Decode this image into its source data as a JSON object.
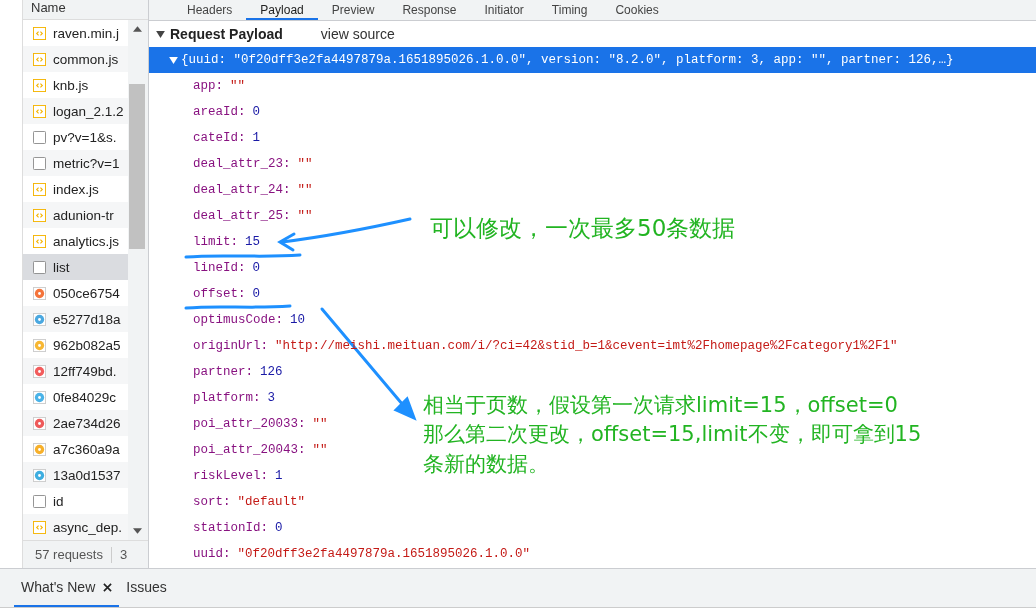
{
  "network_list": {
    "header": "Name",
    "items": [
      {
        "name": "raven.min.j",
        "kind": "script",
        "selected": false
      },
      {
        "name": "common.js",
        "kind": "script",
        "selected": false
      },
      {
        "name": "knb.js",
        "kind": "script",
        "selected": false
      },
      {
        "name": "logan_2.1.2",
        "kind": "script",
        "selected": false
      },
      {
        "name": "pv?v=1&s.",
        "kind": "document",
        "selected": false
      },
      {
        "name": "metric?v=1",
        "kind": "document",
        "selected": false
      },
      {
        "name": "index.js",
        "kind": "script",
        "selected": false
      },
      {
        "name": "adunion-tr",
        "kind": "script",
        "selected": false
      },
      {
        "name": "analytics.js",
        "kind": "script",
        "selected": false
      },
      {
        "name": "list",
        "kind": "document",
        "selected": true
      },
      {
        "name": "050ce6754",
        "kind": "image",
        "color": "#f4743b",
        "selected": false
      },
      {
        "name": "e5277d18a",
        "kind": "image",
        "color": "#4aa8e0",
        "selected": false
      },
      {
        "name": "962b082a5",
        "kind": "image",
        "color": "#f7b733",
        "selected": false
      },
      {
        "name": "12ff749bd.",
        "kind": "image",
        "color": "#f25c5c",
        "selected": false
      },
      {
        "name": "0fe84029c",
        "kind": "image",
        "color": "#4ab3e8",
        "selected": false
      },
      {
        "name": "2ae734d26",
        "kind": "image",
        "color": "#ee5a5a",
        "selected": false
      },
      {
        "name": "a7c360a9a",
        "kind": "image",
        "color": "#f7b02a",
        "selected": false
      },
      {
        "name": "13a0d1537",
        "kind": "image",
        "color": "#3eaee0",
        "selected": false
      },
      {
        "name": "id",
        "kind": "document",
        "selected": false
      },
      {
        "name": "async_dep.",
        "kind": "script",
        "selected": false
      }
    ],
    "status": "57 requests",
    "status_extra": "3"
  },
  "tabs": [
    {
      "label": "Headers",
      "selected": false
    },
    {
      "label": "Payload",
      "selected": true
    },
    {
      "label": "Preview",
      "selected": false
    },
    {
      "label": "Response",
      "selected": false
    },
    {
      "label": "Initiator",
      "selected": false
    },
    {
      "label": "Timing",
      "selected": false
    },
    {
      "label": "Cookies",
      "selected": false
    }
  ],
  "payload": {
    "title": "Request Payload",
    "view_source": "view source",
    "expanded": true,
    "summary": "{uuid: \"0f20dff3e2fa4497879a.1651895026.1.0.0\", version: \"8.2.0\", platform: 3, app: \"\", partner: 126,…}",
    "fields": [
      {
        "key": "app:",
        "value": "\"\"",
        "kind": "string"
      },
      {
        "key": "areaId:",
        "value": "0",
        "kind": "number"
      },
      {
        "key": "cateId:",
        "value": "1",
        "kind": "number"
      },
      {
        "key": "deal_attr_23:",
        "value": "\"\"",
        "kind": "string"
      },
      {
        "key": "deal_attr_24:",
        "value": "\"\"",
        "kind": "string"
      },
      {
        "key": "deal_attr_25:",
        "value": "\"\"",
        "kind": "string"
      },
      {
        "key": "limit:",
        "value": "15",
        "kind": "number"
      },
      {
        "key": "lineId:",
        "value": "0",
        "kind": "number"
      },
      {
        "key": "offset:",
        "value": "0",
        "kind": "number"
      },
      {
        "key": "optimusCode:",
        "value": "10",
        "kind": "number"
      },
      {
        "key": "originUrl:",
        "value": "\"http://meishi.meituan.com/i/?ci=42&stid_b=1&cevent=imt%2Fhomepage%2Fcategory1%2F1\"",
        "kind": "string"
      },
      {
        "key": "partner:",
        "value": "126",
        "kind": "number"
      },
      {
        "key": "platform:",
        "value": "3",
        "kind": "number"
      },
      {
        "key": "poi_attr_20033:",
        "value": "\"\"",
        "kind": "string"
      },
      {
        "key": "poi_attr_20043:",
        "value": "\"\"",
        "kind": "string"
      },
      {
        "key": "riskLevel:",
        "value": "1",
        "kind": "number"
      },
      {
        "key": "sort:",
        "value": "\"default\"",
        "kind": "string"
      },
      {
        "key": "stationId:",
        "value": "0",
        "kind": "number"
      },
      {
        "key": "uuid:",
        "value": "\"0f20dff3e2fa4497879a.1651895026.1.0.0\"",
        "kind": "string"
      }
    ]
  },
  "annotations": [
    {
      "text": "可以修改，一次最多50条数据"
    },
    {
      "text": "相当于页数，假设第一次请求limit=15，offset=0\n那么第二次更改，offset=15,limit不变，即可拿到15\n条新的数据。"
    }
  ],
  "drawer_tabs": [
    {
      "label": "What's New",
      "selected": true,
      "closable": true
    },
    {
      "label": "Issues",
      "selected": false,
      "closable": false
    }
  ]
}
